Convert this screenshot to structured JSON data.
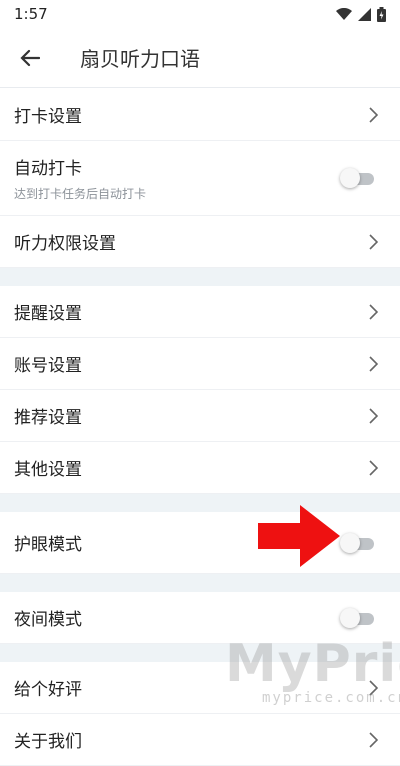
{
  "status_bar": {
    "time": "1:57"
  },
  "header": {
    "title": "扇贝听力口语"
  },
  "sections": [
    {
      "rows": [
        {
          "label": "打卡设置",
          "type": "nav"
        },
        {
          "label": "自动打卡",
          "sub": "达到打卡任务后自动打卡",
          "type": "toggle",
          "on": false
        },
        {
          "label": "听力权限设置",
          "type": "nav"
        }
      ]
    },
    {
      "rows": [
        {
          "label": "提醒设置",
          "type": "nav"
        },
        {
          "label": "账号设置",
          "type": "nav"
        },
        {
          "label": "推荐设置",
          "type": "nav"
        },
        {
          "label": "其他设置",
          "type": "nav"
        }
      ]
    },
    {
      "rows": [
        {
          "label": "护眼模式",
          "type": "toggle",
          "on": false
        }
      ]
    },
    {
      "rows": [
        {
          "label": "夜间模式",
          "type": "toggle",
          "on": false
        }
      ]
    },
    {
      "rows": [
        {
          "label": "给个好评",
          "type": "nav"
        },
        {
          "label": "关于我们",
          "type": "nav"
        }
      ]
    }
  ],
  "watermark": {
    "brand": "MyPrice",
    "site": "myprice.com.cn"
  }
}
